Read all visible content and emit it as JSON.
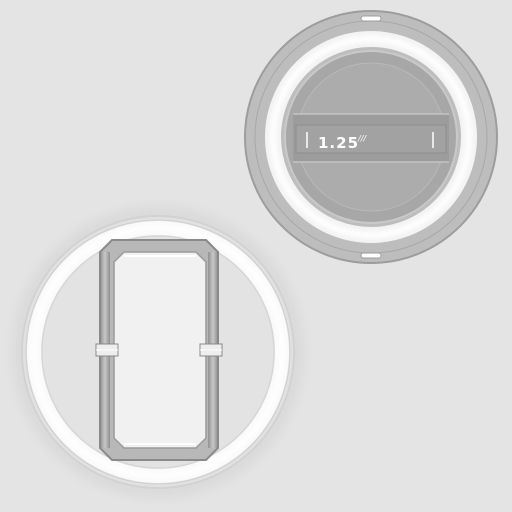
{
  "zoom_gauge": {
    "value": "1.25",
    "unit_mark": "///"
  },
  "colors": {
    "background": "#e4e4e4",
    "ring_gray": "#b9b9b9",
    "ring_light": "#f7f7f7",
    "disc_gray": "#a9a9a9",
    "band_gray": "#9c9c9c",
    "frame_dark": "#8c8c8c",
    "panel_light": "#f1f1f1"
  }
}
